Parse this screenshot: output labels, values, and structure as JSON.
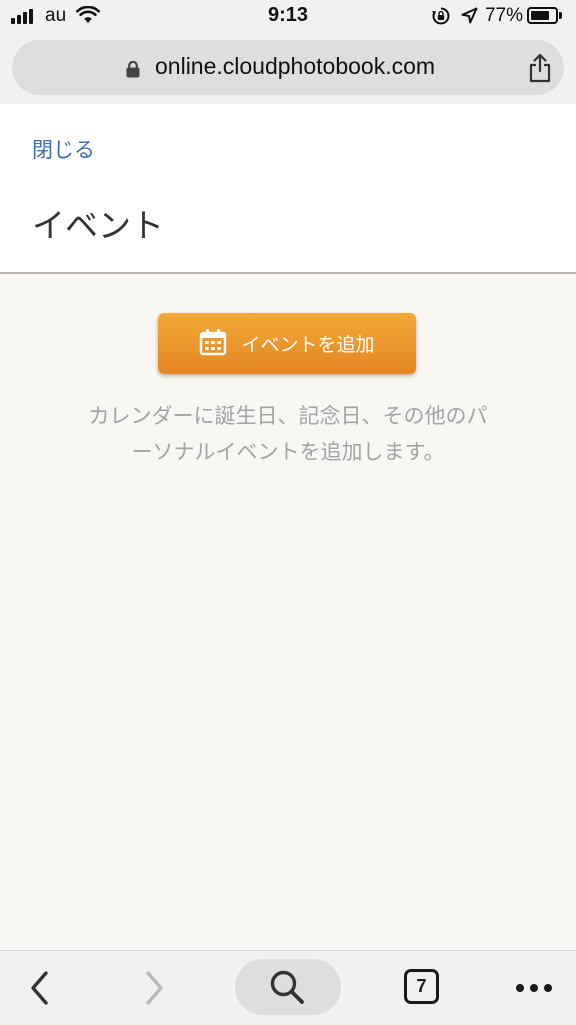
{
  "status_bar": {
    "carrier": "au",
    "time": "9:13",
    "battery_percent": "77%",
    "battery_level": 0.77,
    "icons": [
      "signal-icon",
      "wifi-icon",
      "rotation-lock-icon",
      "location-arrow-icon",
      "battery-icon"
    ]
  },
  "browser": {
    "url": "online.cloudphotobook.com",
    "tab_count": "7",
    "toolbar_icons": [
      "back-icon",
      "forward-icon",
      "search-icon",
      "tabs-icon",
      "more-icon"
    ]
  },
  "header": {
    "close_label": "閉じる",
    "title": "イベント"
  },
  "main": {
    "add_event_label": "イベントを追加",
    "description": "カレンダーに誕生日、記念日、その他のパーソナルイベントを追加します。"
  },
  "colors": {
    "link": "#3e6db4",
    "accent": "#eb9a2e",
    "page_background": "#f8f7f4",
    "muted_text": "#a3a3a3"
  }
}
